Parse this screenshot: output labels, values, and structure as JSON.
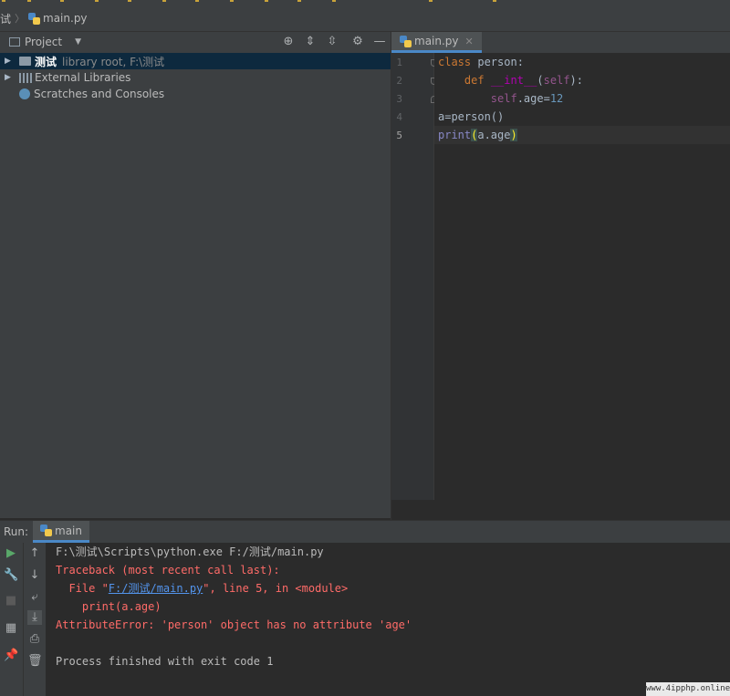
{
  "navbar": {
    "project": "试",
    "separator": "〉",
    "file": "main.py"
  },
  "project_panel": {
    "title": "Project",
    "tree": [
      {
        "label": "测试",
        "detail": "library root,  F:\\测试",
        "expandable": true,
        "selected": true
      },
      {
        "label": "External Libraries",
        "expandable": true,
        "selected": false
      },
      {
        "label": "Scratches and Consoles",
        "expandable": false,
        "selected": false
      }
    ]
  },
  "editor": {
    "tab": "main.py",
    "line_numbers": [
      "1",
      "2",
      "3",
      "4",
      "5"
    ],
    "lines": [
      {
        "indent": "",
        "parts": [
          "class",
          " person:"
        ]
      },
      {
        "indent": "    ",
        "parts": [
          "def",
          " ",
          "__int__",
          "(",
          "self",
          "):"
        ]
      },
      {
        "indent": "        ",
        "parts": [
          "self",
          ".age=",
          "12"
        ]
      },
      {
        "indent": "",
        "parts": [
          "a=person()"
        ]
      },
      {
        "indent": "",
        "parts": [
          "print",
          "(",
          "a.age",
          ")"
        ]
      }
    ]
  },
  "run_panel": {
    "label": "Run:",
    "tab": "main",
    "console": [
      {
        "text": "F:\\测试\\Scripts\\python.exe F:/测试/main.py",
        "style": "normal"
      },
      {
        "text": "Traceback (most recent call last):",
        "style": "error"
      },
      {
        "prefix": "  File \"",
        "link": "F:/测试/main.py",
        "suffix": "\", line 5, in <module>",
        "style": "error"
      },
      {
        "text": "    print(a.age)",
        "style": "error"
      },
      {
        "text": "AttributeError: 'person' object has no attribute 'age'",
        "style": "error"
      },
      {
        "text": "",
        "style": "normal"
      },
      {
        "text": "Process finished with exit code 1",
        "style": "normal"
      }
    ]
  },
  "watermark": "www.4ipphp.online",
  "colors": {
    "keyword": "#cc7832",
    "self": "#94558d",
    "dunder": "#b200b2",
    "number": "#6897bb",
    "builtin": "#8888c6",
    "error": "#ff6b68",
    "link": "#5394ec",
    "selection": "#0d293e"
  }
}
